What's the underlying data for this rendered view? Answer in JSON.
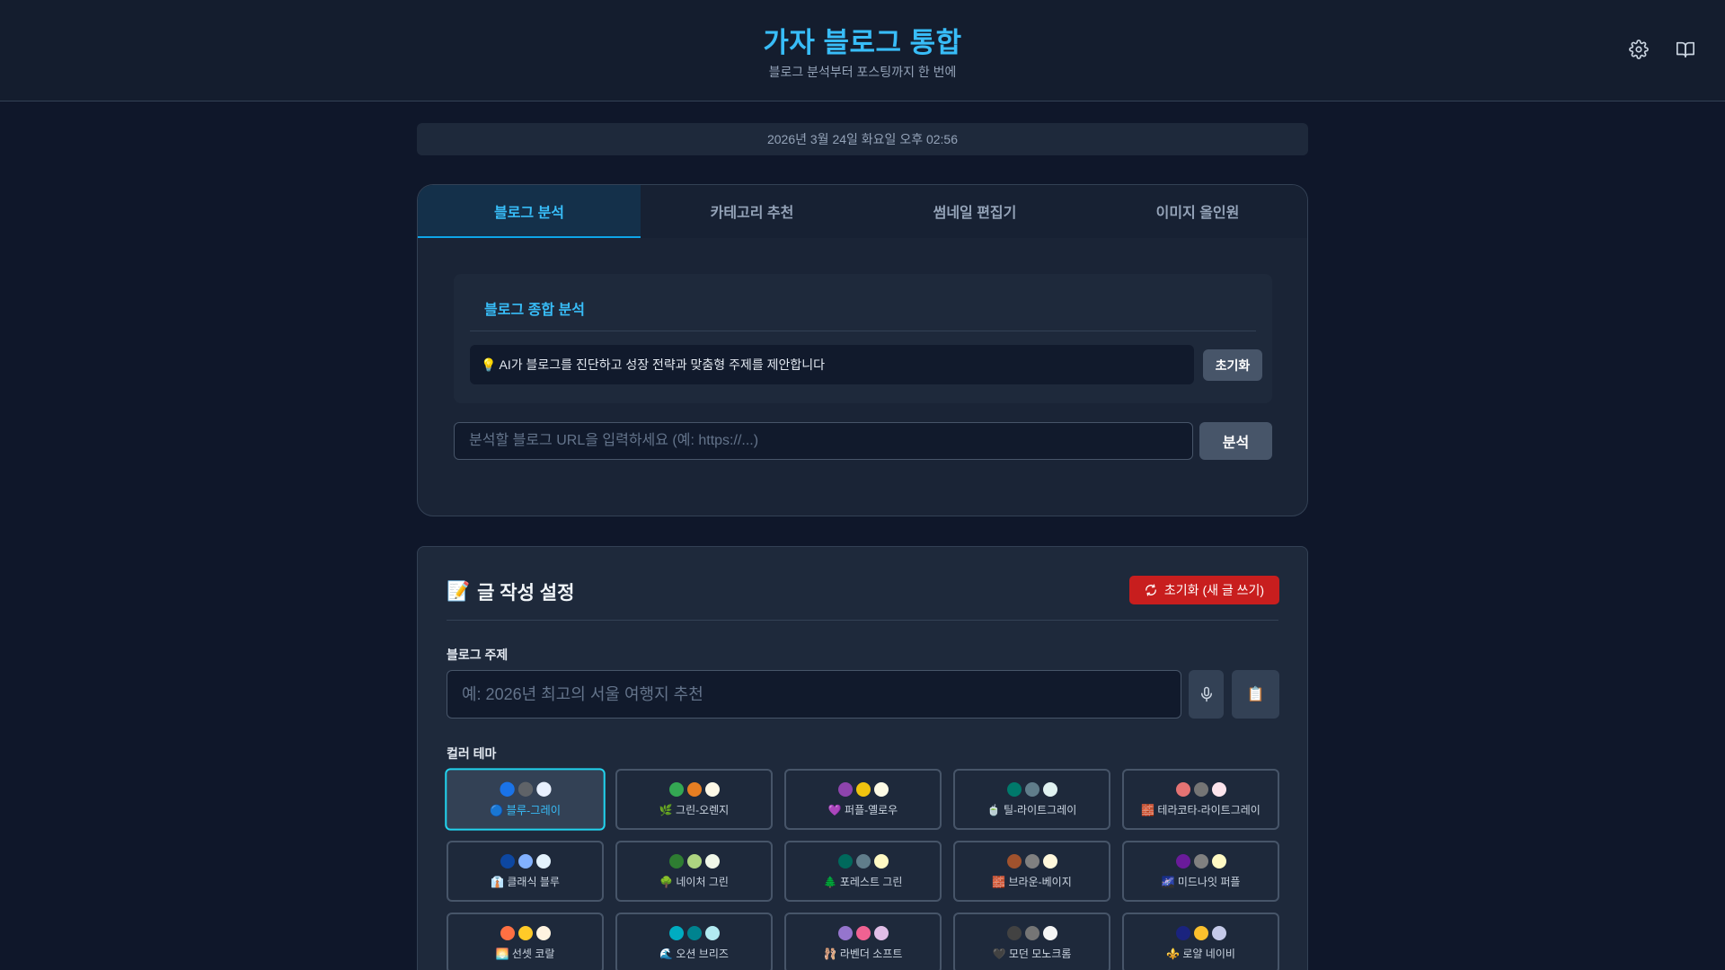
{
  "header": {
    "title": "가자 블로그 통합",
    "subtitle": "블로그 분석부터 포스팅까지 한 번에"
  },
  "datetime": "2026년 3월 24일 화요일 오후 02:56",
  "tabs": [
    {
      "label": "블로그 분석",
      "active": true
    },
    {
      "label": "카테고리 추천",
      "active": false
    },
    {
      "label": "썸네일 편집기",
      "active": false
    },
    {
      "label": "이미지 올인원",
      "active": false
    }
  ],
  "analysis": {
    "card_title": "블로그 종합 분석",
    "info_text": "💡 AI가 블로그를 진단하고 성장 전략과 맞춤형 주제를 제안합니다",
    "reset_label": "초기화",
    "url_placeholder": "분석할 블로그 URL을 입력하세요 (예: https://...)",
    "analyze_label": "분석"
  },
  "settings": {
    "title": "글 작성 설정",
    "title_emoji": "📝",
    "reset_new_label": "초기화 (새 글 쓰기)",
    "topic_label": "블로그 주제",
    "topic_placeholder": "예: 2026년 최고의 서울 여행지 추천",
    "clipboard_glyph": "📋",
    "theme_label": "컬러 테마",
    "themes": [
      {
        "name": "🔵 블루-그레이",
        "colors": [
          "#1a73e8",
          "#5f6368",
          "#e8f0fe"
        ],
        "selected": true
      },
      {
        "name": "🌿 그린-오렌지",
        "colors": [
          "#34a853",
          "#e67e22",
          "#fef9e7"
        ],
        "selected": false
      },
      {
        "name": "💜 퍼플-옐로우",
        "colors": [
          "#8e44ad",
          "#f1c40f",
          "#fdfae5"
        ],
        "selected": false
      },
      {
        "name": "🍵 틸-라이트그레이",
        "colors": [
          "#00796b",
          "#607d8b",
          "#e0f2f1"
        ],
        "selected": false
      },
      {
        "name": "🧱 테라코타-라이트그레이",
        "colors": [
          "#e57373",
          "#757575",
          "#fce4ec"
        ],
        "selected": false
      },
      {
        "name": "👔 클래식 블루",
        "colors": [
          "#0d47a1",
          "#82b1ff",
          "#e3f2fd"
        ],
        "selected": false
      },
      {
        "name": "🌳 네이처 그린",
        "colors": [
          "#2e7d32",
          "#aed581",
          "#f1f8e9"
        ],
        "selected": false
      },
      {
        "name": "🌲 포레스트 그린",
        "colors": [
          "#00695c",
          "#607d8b",
          "#fff9c4"
        ],
        "selected": false
      },
      {
        "name": "🧱 브라운-베이지",
        "colors": [
          "#a0522d",
          "#808080",
          "#fff8dc"
        ],
        "selected": false
      },
      {
        "name": "🌌 미드나잇 퍼플",
        "colors": [
          "#6a1b9a",
          "#808080",
          "#fff9c4"
        ],
        "selected": false
      },
      {
        "name": "🌅 선셋 코랄",
        "colors": [
          "#ff7043",
          "#ffca28",
          "#fff3e0"
        ],
        "selected": false
      },
      {
        "name": "🌊 오션 브리즈",
        "colors": [
          "#00acc1",
          "#00838f",
          "#b2ebf2"
        ],
        "selected": false
      },
      {
        "name": "🩰 라벤더 소프트",
        "colors": [
          "#9575cd",
          "#f06292",
          "#e1bee7"
        ],
        "selected": false
      },
      {
        "name": "🖤 모던 모노크롬",
        "colors": [
          "#424242",
          "#757575",
          "#f5f5f5"
        ],
        "selected": false
      },
      {
        "name": "⚜️ 로얄 네이비",
        "colors": [
          "#1a237e",
          "#fbc02d",
          "#c5cae9"
        ],
        "selected": false
      }
    ]
  },
  "colors": {
    "accent": "#38bdf8",
    "danger": "#c81e1e",
    "background": "#0f172a"
  }
}
